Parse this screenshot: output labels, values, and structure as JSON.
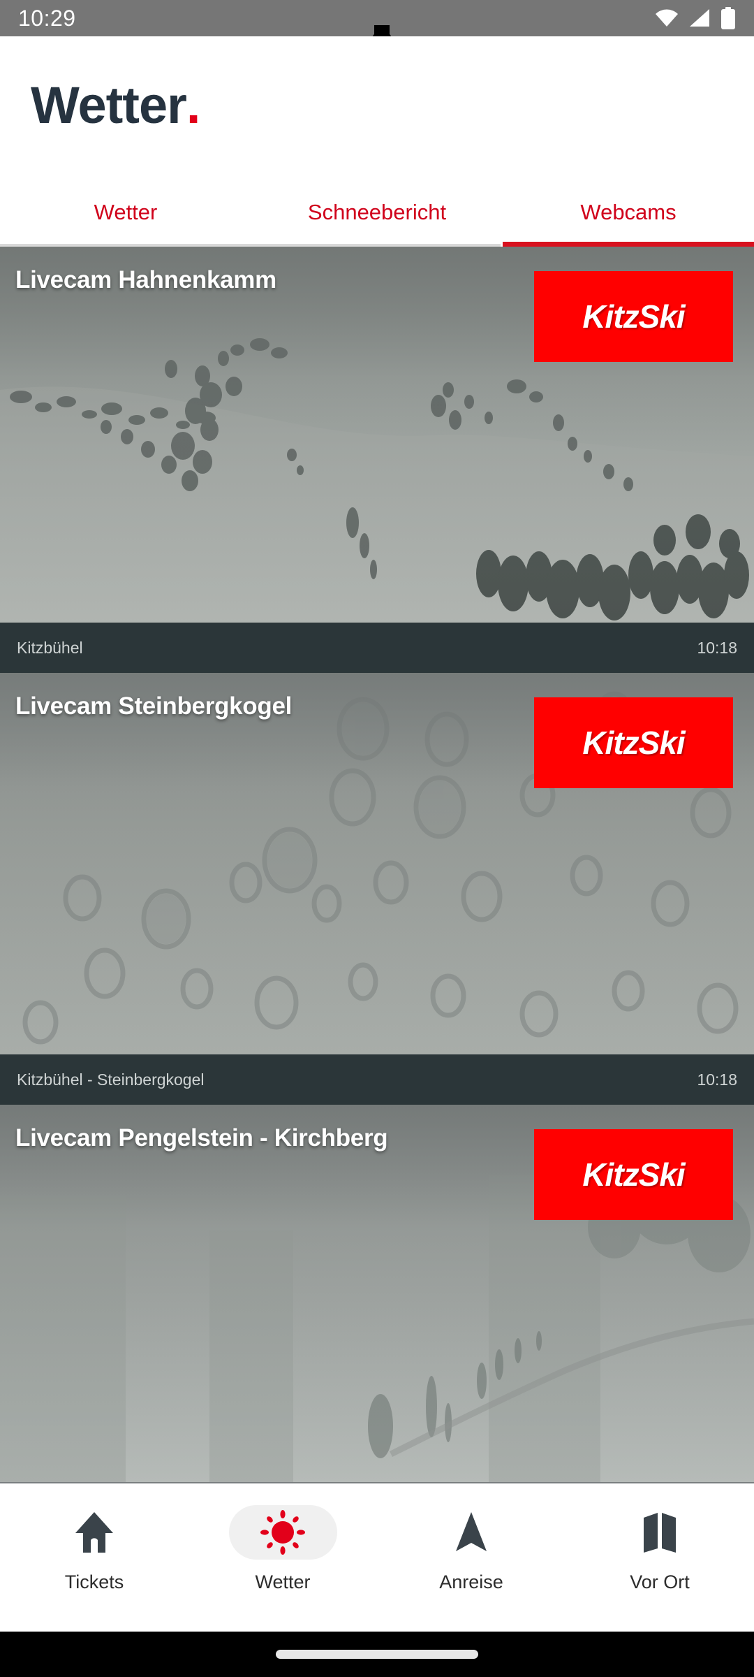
{
  "status_bar": {
    "time": "10:29",
    "icons": [
      "wifi-icon",
      "cellular-signal-icon",
      "battery-icon"
    ]
  },
  "header": {
    "logo_text": "Wetter",
    "logo_dot": ".",
    "logo_color": "#263340",
    "accent_color": "#e2001a"
  },
  "tabs": {
    "active_index": 2,
    "items": [
      {
        "label": "Wetter"
      },
      {
        "label": "Schneebericht"
      },
      {
        "label": "Webcams"
      }
    ],
    "indicator_color": "#d8111f"
  },
  "webcams": [
    {
      "title": "Livecam Hahnenkamm",
      "brand": "KitzSki",
      "location": "Kitzbühel",
      "time": "10:18",
      "scene": "snowy-mountain-with-trees"
    },
    {
      "title": "Livecam Steinbergkogel",
      "brand": "KitzSki",
      "location": "Kitzbühel - Steinbergkogel",
      "time": "10:18",
      "scene": "blurry-lens-droplets"
    },
    {
      "title": "Livecam Pengelstein - Kirchberg",
      "brand": "KitzSki",
      "location": "",
      "time": "",
      "scene": "foggy-whiteout-slope"
    }
  ],
  "bottom_nav": {
    "active_index": 1,
    "items": [
      {
        "label": "Tickets",
        "icon": "home-icon"
      },
      {
        "label": "Wetter",
        "icon": "sun-icon"
      },
      {
        "label": "Anreise",
        "icon": "navigation-arrow-icon"
      },
      {
        "label": "Vor Ort",
        "icon": "map-icon"
      }
    ],
    "active_icon_color": "#e2001a",
    "inactive_icon_color": "#3a434a"
  }
}
